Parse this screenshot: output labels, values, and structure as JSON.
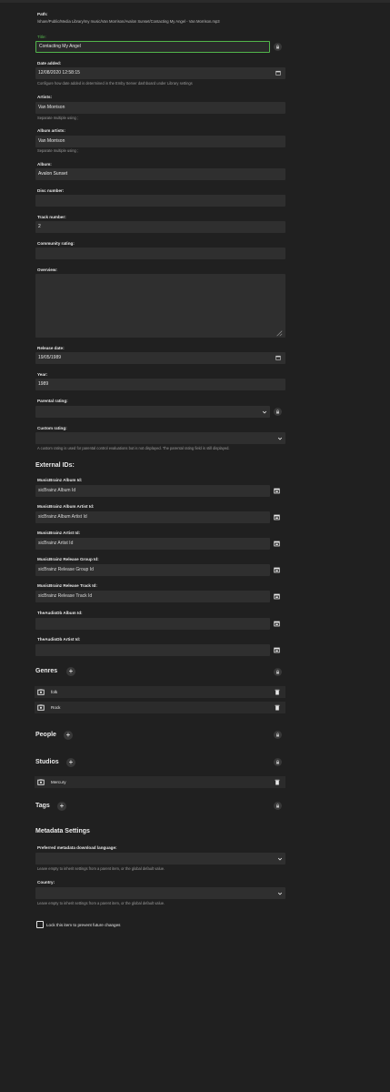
{
  "path": {
    "label": "Path:",
    "value": "/share/Public/Media Library/my music/Van Morrison/Avalon Sunset/Contacting My Angel - Van Morrison.mp3"
  },
  "title": {
    "label": "Title:",
    "value": "Contacting My Angel"
  },
  "date_added": {
    "label": "Date added:",
    "value": "12/08/2020 12:58:15",
    "hint": "Configure how date added is determined in the Emby Server dashboard under Library settings"
  },
  "artists": {
    "label": "Artists:",
    "value": "Van Morrison",
    "hint": "Separate multiple using ;"
  },
  "album_artists": {
    "label": "Album artists:",
    "value": "Van Morrison",
    "hint": "Separate multiple using ;"
  },
  "album": {
    "label": "Album:",
    "value": "Avalon Sunset"
  },
  "disc_number": {
    "label": "Disc number:",
    "value": ""
  },
  "track_number": {
    "label": "Track number:",
    "value": "2"
  },
  "community_rating": {
    "label": "Community rating:",
    "value": ""
  },
  "overview": {
    "label": "Overview:",
    "value": ""
  },
  "release_date": {
    "label": "Release date:",
    "value": "19/05/1989"
  },
  "year": {
    "label": "Year:",
    "value": "1989"
  },
  "parental_rating": {
    "label": "Parental rating:",
    "value": ""
  },
  "custom_rating": {
    "label": "Custom rating:",
    "value": "",
    "hint": "A custom rating is used for parental control evaluations but is not displayed. The parental rating field is still displayed."
  },
  "external_ids": {
    "title": "External IDs:",
    "items": [
      {
        "label": "MusicBrainz Album Id:",
        "placeholder": "sicBrainz Album Id"
      },
      {
        "label": "MusicBrainz Album Artist Id:",
        "placeholder": "sicBrainz Album Artist Id"
      },
      {
        "label": "MusicBrainz Artist Id:",
        "placeholder": "sicBrainz Artist Id"
      },
      {
        "label": "MusicBrainz Release Group Id:",
        "placeholder": "sicBrainz Release Group Id"
      },
      {
        "label": "MusicBrainz Release Track Id:",
        "placeholder": "sicBrainz Release Track Id"
      },
      {
        "label": "TheAudioDb Album Id:",
        "placeholder": ""
      },
      {
        "label": "TheAudioDb Artist Id:",
        "placeholder": ""
      }
    ]
  },
  "genres": {
    "title": "Genres",
    "add": "+",
    "items": [
      "folk",
      "Rock"
    ]
  },
  "people": {
    "title": "People",
    "add": "+"
  },
  "studios": {
    "title": "Studios",
    "add": "+",
    "items": [
      "Mercury"
    ]
  },
  "tags": {
    "title": "Tags",
    "add": "+"
  },
  "metadata_settings": {
    "title": "Metadata Settings",
    "language_label": "Preferred metadata download language:",
    "language_hint": "Leave empty to inherit settings from a parent item, or the global default value.",
    "country_label": "Country:",
    "country_hint": "Leave empty to inherit settings from a parent item, or the global default value.",
    "lock_label": "Lock this item to prevent future changes"
  }
}
